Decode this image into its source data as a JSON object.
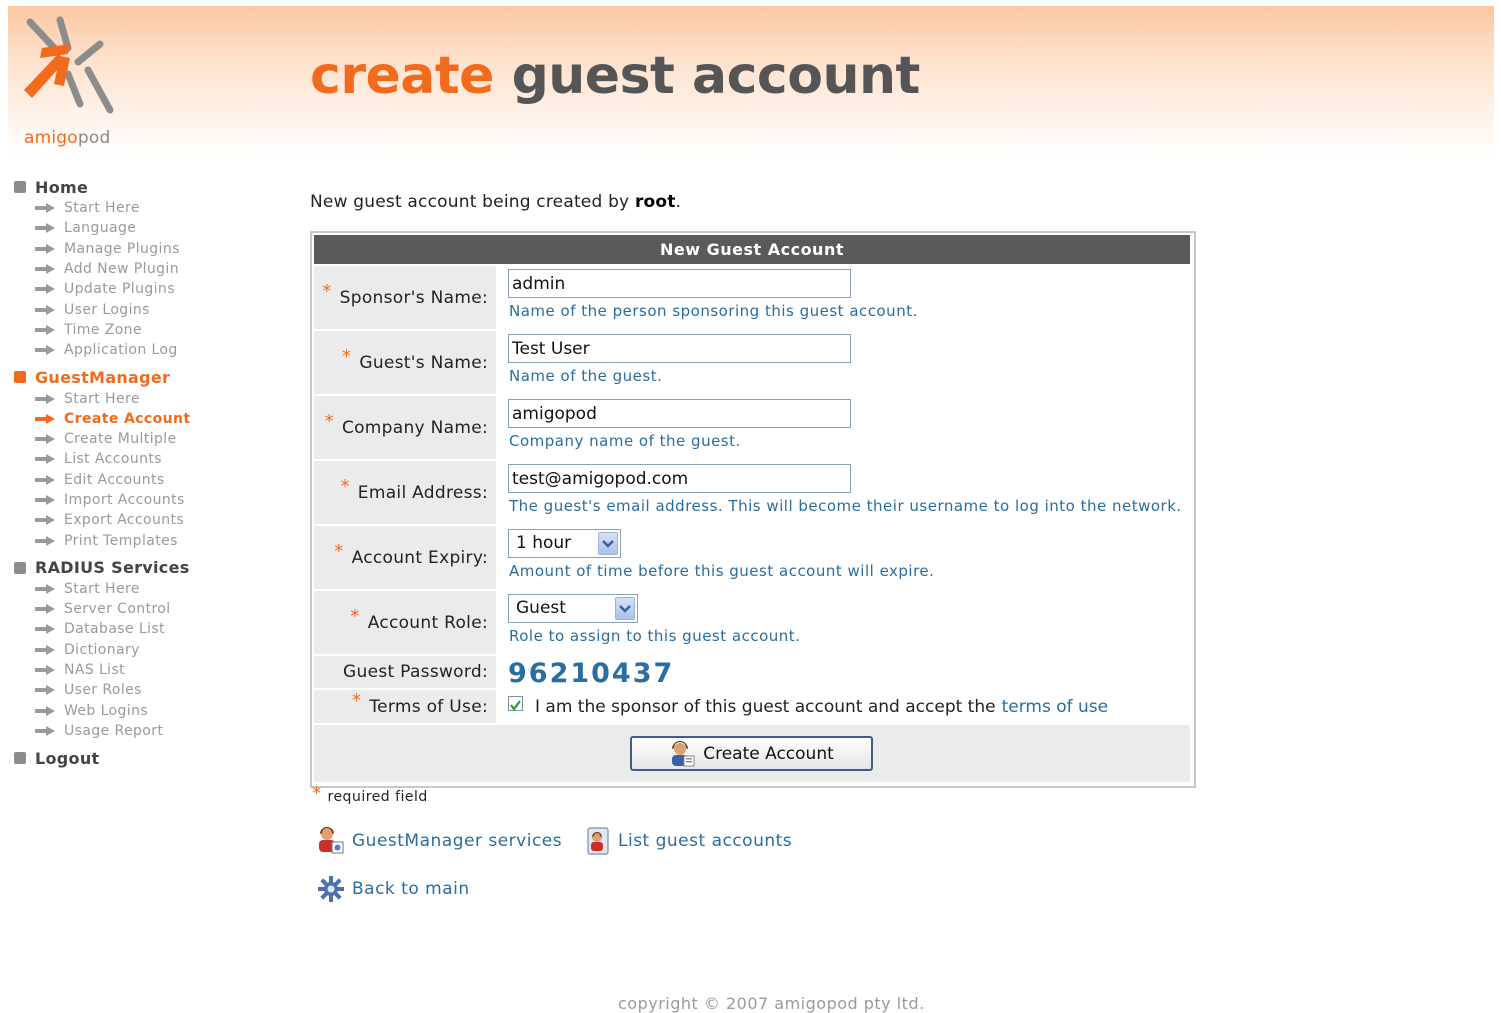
{
  "logo": {
    "text_a": "amigo",
    "text_b": "pod"
  },
  "title": {
    "part1": "create",
    "part2": "guest account"
  },
  "sidebar": {
    "sections": [
      {
        "label": "Home",
        "items": [
          "Start Here",
          "Language",
          "Manage Plugins",
          "Add New Plugin",
          "Update Plugins",
          "User Logins",
          "Time Zone",
          "Application Log"
        ]
      },
      {
        "label": "GuestManager",
        "items": [
          "Start Here",
          "Create Account",
          "Create Multiple",
          "List Accounts",
          "Edit Accounts",
          "Import Accounts",
          "Export Accounts",
          "Print Templates"
        ],
        "current_item": "Create Account"
      },
      {
        "label": "RADIUS Services",
        "items": [
          "Start Here",
          "Server Control",
          "Database List",
          "Dictionary",
          "NAS List",
          "User Roles",
          "Web Logins",
          "Usage Report"
        ]
      },
      {
        "label": "Logout",
        "items": []
      }
    ]
  },
  "intro": {
    "prefix": "New guest account being created by",
    "user": "root",
    "suffix": "."
  },
  "form": {
    "heading": "New Guest Account",
    "sponsor": {
      "label": "Sponsor's Name:",
      "value": "admin",
      "hint": "Name of the person sponsoring this guest account."
    },
    "guest": {
      "label": "Guest's Name:",
      "value": "Test User",
      "hint": "Name of the guest."
    },
    "company": {
      "label": "Company Name:",
      "value": "amigopod",
      "hint": "Company name of the guest."
    },
    "email": {
      "label": "Email Address:",
      "value": "test@amigopod.com",
      "hint": "The guest's email address. This will become their username to log into the network."
    },
    "expiry": {
      "label": "Account Expiry:",
      "value": "1 hour",
      "hint": "Amount of time before this guest account will expire."
    },
    "role": {
      "label": "Account Role:",
      "value": "Guest",
      "hint": "Role to assign to this guest account."
    },
    "password": {
      "label": "Guest Password:",
      "value": "96210437"
    },
    "terms": {
      "label": "Terms of Use:",
      "text": "I am the sponsor of this guest account and accept the",
      "link": "terms of use",
      "checked": true
    },
    "submit_label": "Create Account"
  },
  "required_note": "required field",
  "links": {
    "services": "GuestManager services",
    "list": "List guest accounts",
    "back": "Back to main"
  },
  "footer": "copyright © 2007 amigopod pty ltd.",
  "colors": {
    "accent": "#f26b1d",
    "link": "#2a6da0",
    "header_bar": "#5a5a5a"
  }
}
